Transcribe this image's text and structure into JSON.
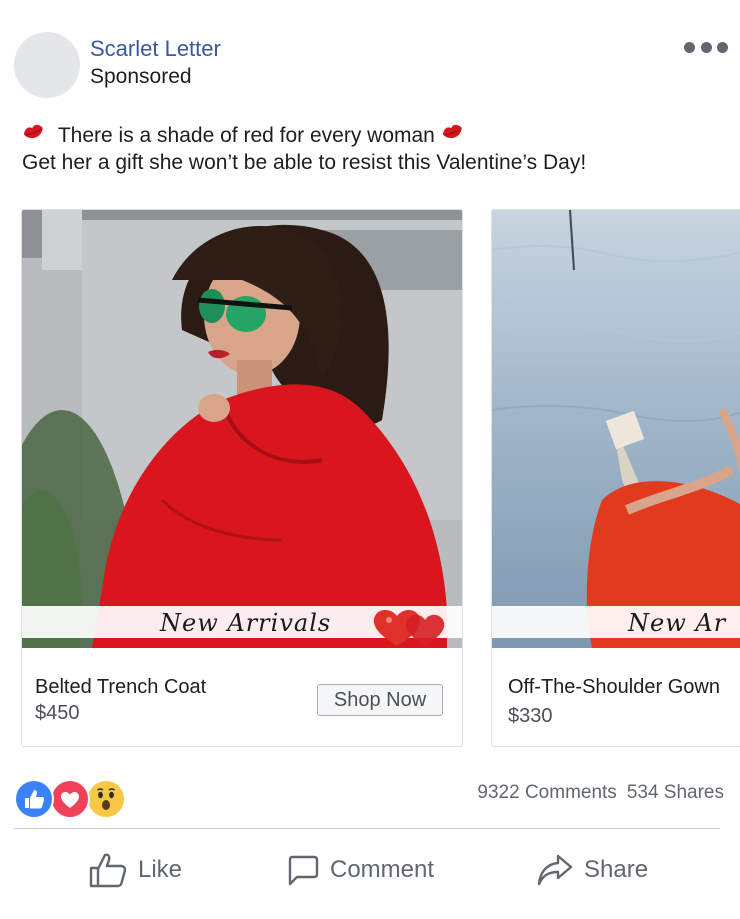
{
  "post": {
    "page_name": "Scarlet Letter",
    "sponsored_label": "Sponsored",
    "more_icon": "more-options-icon",
    "caption_line1": "There is a shade of red for every woman",
    "caption_line2": "Get her a gift she won’t be able to resist this Valentine’s Day!",
    "caption_emoji": "kiss-lips-icon"
  },
  "carousel": {
    "cards": [
      {
        "banner": "New Arrivals",
        "title": "Belted Trench Coat",
        "price": "$450",
        "cta": "Shop Now"
      },
      {
        "banner": "New Ar",
        "title": "Off-The-Shoulder Gown",
        "price": "$330"
      }
    ]
  },
  "engagement": {
    "reactions": [
      "like-icon",
      "love-icon",
      "wow-icon"
    ],
    "comments": "9322 Comments",
    "shares": "534 Shares"
  },
  "actions": {
    "like": "Like",
    "comment": "Comment",
    "share": "Share"
  },
  "colors": {
    "brand_blue": "#3b5998",
    "text": "#1c1e21",
    "secondary": "#606770",
    "accent_red": "#d9161e"
  }
}
